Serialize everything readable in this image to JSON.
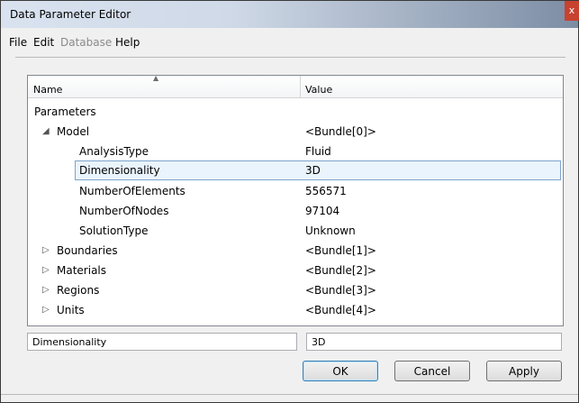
{
  "window": {
    "title": "Data Parameter Editor",
    "close_glyph": "x"
  },
  "menu": [
    {
      "label": "File",
      "enabled": true
    },
    {
      "label": "Edit",
      "enabled": true
    },
    {
      "label": "Database",
      "enabled": false
    },
    {
      "label": "Help",
      "enabled": true
    }
  ],
  "tree": {
    "columns": {
      "name": "Name",
      "value": "Value"
    },
    "rows": [
      {
        "name": "Parameters",
        "value": ""
      },
      {
        "name": "Model",
        "value": "<Bundle[0]>"
      },
      {
        "name": "AnalysisType",
        "value": "Fluid"
      },
      {
        "name": "Dimensionality",
        "value": "3D"
      },
      {
        "name": "NumberOfElements",
        "value": "556571"
      },
      {
        "name": "NumberOfNodes",
        "value": "97104"
      },
      {
        "name": "SolutionType",
        "value": "Unknown"
      },
      {
        "name": "Boundaries",
        "value": "<Bundle[1]>"
      },
      {
        "name": "Materials",
        "value": "<Bundle[2]>"
      },
      {
        "name": "Regions",
        "value": "<Bundle[3]>"
      },
      {
        "name": "Units",
        "value": "<Bundle[4]>"
      }
    ]
  },
  "editor": {
    "name_value": "Dimensionality",
    "value_value": "3D"
  },
  "buttons": {
    "ok": "OK",
    "cancel": "Cancel",
    "apply": "Apply"
  },
  "icons": {
    "expanded": "expanded-triangle-icon",
    "collapsed": "collapsed-triangle-icon",
    "sort": "sort-ascending-icon"
  },
  "colors": {
    "selection_bg": "#eaf4fc",
    "selection_border": "#7da2ce"
  }
}
